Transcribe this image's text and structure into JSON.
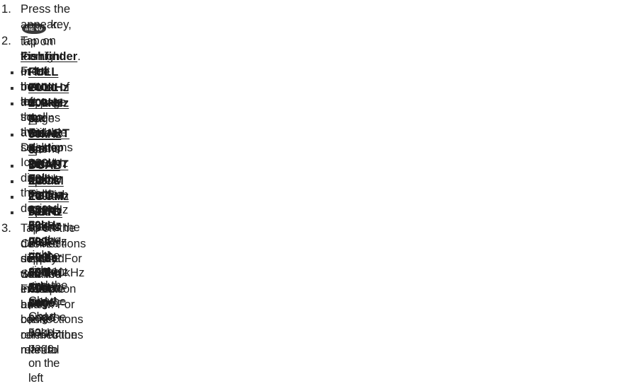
{
  "steps": {
    "s1": {
      "num": "1.",
      "a": "Press the",
      "key": "MENU",
      "b": "key, tap on",
      "link": "Fishfinder",
      "c": ". In the bottom of the page the available selections",
      "d": "appear."
    },
    "s2": {
      "num": "2.",
      "a": "Tap on the right or left  bottom arrow to scroll the Desktop Icons to display the desired",
      "b": "icon. From the left:"
    },
    "s3": {
      "num": "3.",
      "a": "Tap on the desired display. See the example below. For basic connections refer to",
      "b": "Connections section. For detailed installation and connections refer to the manual",
      "c": "supplied with the FF525."
    }
  },
  "bullets": [
    {
      "label": "FULL 200kHz",
      "text": " opens the Fish Finder 200kHz Full page"
    },
    {
      "label": "FULL 50kHz",
      "text": " opens the Fish Finder 50kHz Full page"
    },
    {
      "label": "200kHz & CHART",
      "text": " opens the Fish Finder 200kHz page on the right side and the Chart",
      "text2": "page on the left"
    },
    {
      "label": "50kHz & CHART",
      "text_a": " opens the Fish Finder ",
      "bold": "50kHz",
      "text_b": " page on the right side and the Chart page",
      "text2": "on the left"
    },
    {
      "label": "DUAL",
      "text": " opens the Fish Finder 200kHz page on the right side and the 50kHz page on the left"
    },
    {
      "label": "ZOOM 200kHz",
      "text": " opens the Fish Finder 200kHz Zoom page"
    },
    {
      "label": "ZOOM 50kHz",
      "text": " opens the Fish Finder 50kHz Zoom page"
    },
    {
      "label": "AUTO",
      "text": " opens the Fish Finder 50/200kHz Zoom page."
    }
  ]
}
